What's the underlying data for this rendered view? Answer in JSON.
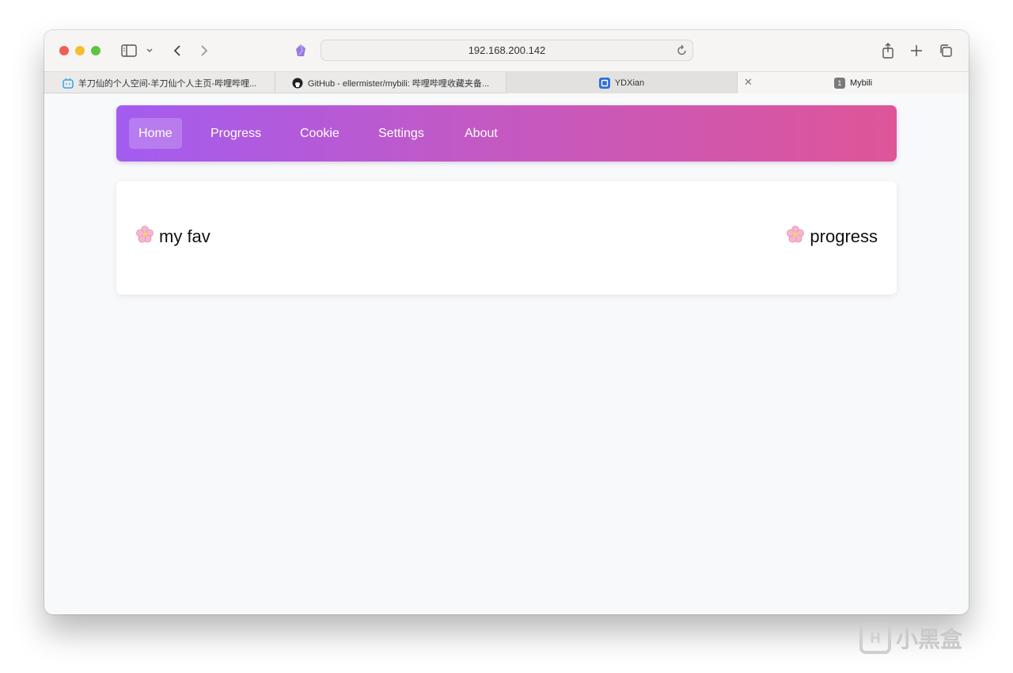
{
  "browser": {
    "url": "192.168.200.142",
    "tabs": [
      {
        "title": "羊刀仙的个人空间-羊刀仙个人主页-哔哩哔哩...",
        "icon": "bilibili-icon"
      },
      {
        "title": "GitHub - ellermister/mybili: 哔哩哔哩收藏夹备...",
        "icon": "github-icon"
      },
      {
        "title": "YDXian",
        "icon": "ydxian-icon"
      },
      {
        "title": "Mybili",
        "icon": "mybili-icon",
        "badge": "1"
      }
    ]
  },
  "nav": {
    "items": [
      "Home",
      "Progress",
      "Cookie",
      "Settings",
      "About"
    ],
    "active": "Home",
    "gradient_start": "#a35cf0",
    "gradient_end": "#de5598"
  },
  "card": {
    "left_link": "my fav",
    "right_link": "progress",
    "icon": "cherry-blossom-icon"
  },
  "watermark": {
    "text": "小黑盒"
  }
}
